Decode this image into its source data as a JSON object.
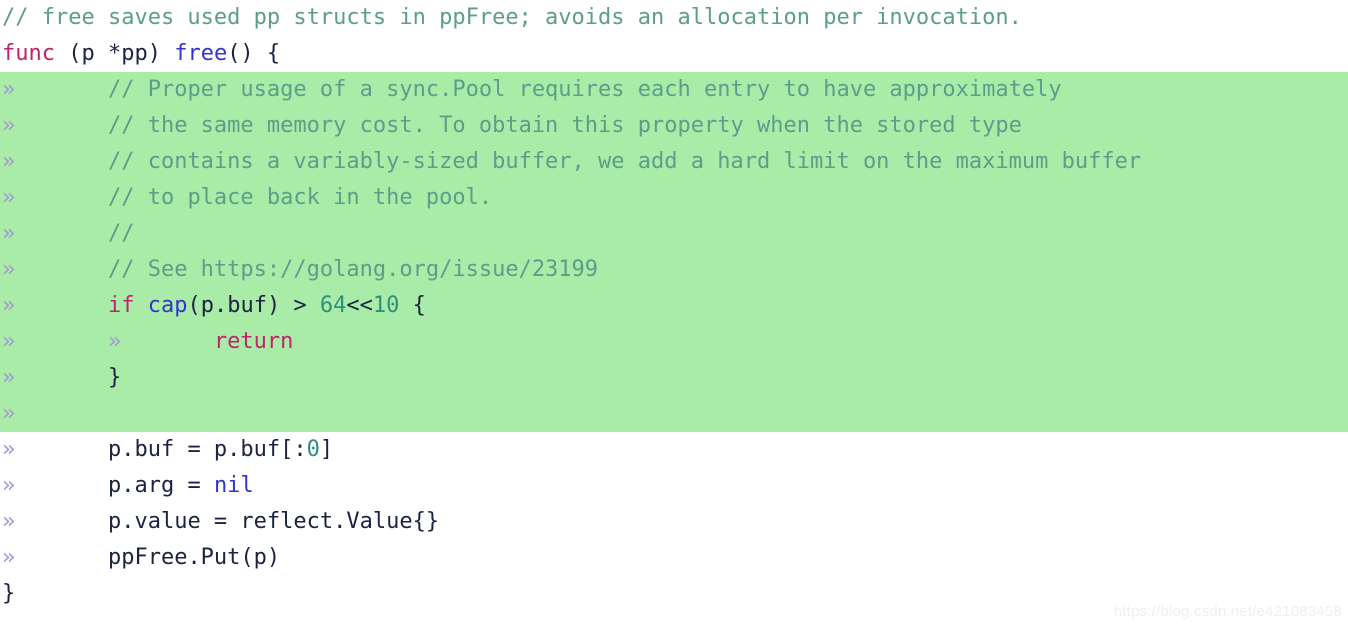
{
  "editor": {
    "language": "go",
    "tab_marker": "»",
    "highlight_color": "#a8eca8",
    "background_color": "#ffffff",
    "colors": {
      "comment": "#5c9e8a",
      "keyword": "#c0246b",
      "builtin": "#3434cc",
      "number": "#2f8f7f",
      "identifier": "#1c2340",
      "tab_marker": "#a09ad0",
      "highlight": "#a8eca8",
      "watermark": "#efefef"
    },
    "lines": [
      {
        "index": 1,
        "highlighted": false,
        "tabs": 0,
        "text": "// free saves used pp structs in ppFree; avoids an allocation per invocation.",
        "tokens": [
          {
            "t": "// free saves used pp structs in ppFree; avoids an allocation per invocation.",
            "c": "c"
          }
        ]
      },
      {
        "index": 2,
        "highlighted": false,
        "tabs": 0,
        "text": "func (p *pp) free() {",
        "tokens": [
          {
            "t": "func",
            "c": "kw"
          },
          {
            "t": " (p *pp) ",
            "c": "id"
          },
          {
            "t": "free",
            "c": "bi"
          },
          {
            "t": "() {",
            "c": "id"
          }
        ]
      },
      {
        "index": 3,
        "highlighted": true,
        "tabs": 1,
        "text": "// Proper usage of a sync.Pool requires each entry to have approximately",
        "tokens": [
          {
            "t": "// Proper usage of a sync.Pool requires each entry to have approximately",
            "c": "c"
          }
        ]
      },
      {
        "index": 4,
        "highlighted": true,
        "tabs": 1,
        "text": "// the same memory cost. To obtain this property when the stored type",
        "tokens": [
          {
            "t": "// the same memory cost. To obtain this property when the stored type",
            "c": "c"
          }
        ]
      },
      {
        "index": 5,
        "highlighted": true,
        "tabs": 1,
        "text": "// contains a variably-sized buffer, we add a hard limit on the maximum buffer",
        "tokens": [
          {
            "t": "// contains a variably-sized buffer, we add a hard limit on the maximum buffer",
            "c": "c"
          }
        ]
      },
      {
        "index": 6,
        "highlighted": true,
        "tabs": 1,
        "text": "// to place back in the pool.",
        "tokens": [
          {
            "t": "// to place back in the pool.",
            "c": "c"
          }
        ]
      },
      {
        "index": 7,
        "highlighted": true,
        "tabs": 1,
        "text": "//",
        "tokens": [
          {
            "t": "//",
            "c": "c"
          }
        ]
      },
      {
        "index": 8,
        "highlighted": true,
        "tabs": 1,
        "text": "// See https://golang.org/issue/23199",
        "tokens": [
          {
            "t": "// See https://golang.org/issue/23199",
            "c": "c"
          }
        ]
      },
      {
        "index": 9,
        "highlighted": true,
        "tabs": 1,
        "text": "if cap(p.buf) > 64<<10 {",
        "tokens": [
          {
            "t": "if",
            "c": "kw"
          },
          {
            "t": " ",
            "c": "id"
          },
          {
            "t": "cap",
            "c": "bi"
          },
          {
            "t": "(p.buf) > ",
            "c": "id"
          },
          {
            "t": "64",
            "c": "num"
          },
          {
            "t": "<<",
            "c": "id"
          },
          {
            "t": "10",
            "c": "num"
          },
          {
            "t": " {",
            "c": "id"
          }
        ]
      },
      {
        "index": 10,
        "highlighted": true,
        "tabs": 2,
        "text": "return",
        "tokens": [
          {
            "t": "return",
            "c": "kw"
          }
        ]
      },
      {
        "index": 11,
        "highlighted": true,
        "tabs": 1,
        "text": "}",
        "tokens": [
          {
            "t": "}",
            "c": "id"
          }
        ]
      },
      {
        "index": 12,
        "highlighted": true,
        "tabs": 1,
        "text": "",
        "tokens": []
      },
      {
        "index": 13,
        "highlighted": false,
        "tabs": 1,
        "text": "p.buf = p.buf[:0]",
        "tokens": [
          {
            "t": "p.buf = p.buf[:",
            "c": "id"
          },
          {
            "t": "0",
            "c": "num"
          },
          {
            "t": "]",
            "c": "id"
          }
        ]
      },
      {
        "index": 14,
        "highlighted": false,
        "tabs": 1,
        "text": "p.arg = nil",
        "tokens": [
          {
            "t": "p.arg = ",
            "c": "id"
          },
          {
            "t": "nil",
            "c": "bi"
          }
        ]
      },
      {
        "index": 15,
        "highlighted": false,
        "tabs": 1,
        "text": "p.value = reflect.Value{}",
        "tokens": [
          {
            "t": "p.value = reflect.Value{}",
            "c": "id"
          }
        ]
      },
      {
        "index": 16,
        "highlighted": false,
        "tabs": 1,
        "text": "ppFree.Put(p)",
        "tokens": [
          {
            "t": "ppFree.Put(p)",
            "c": "id"
          }
        ]
      },
      {
        "index": 17,
        "highlighted": false,
        "tabs": 0,
        "text": "}",
        "tokens": [
          {
            "t": "}",
            "c": "id"
          }
        ]
      }
    ]
  },
  "watermark": {
    "text": "https://blog.csdn.net/e421083458"
  }
}
